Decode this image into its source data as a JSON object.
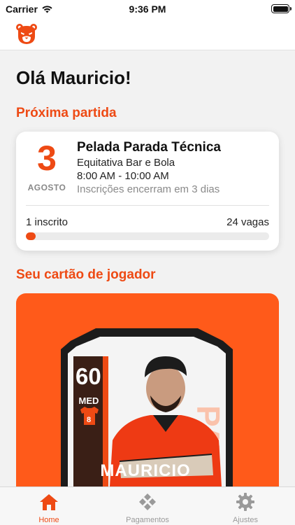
{
  "status": {
    "carrier": "Carrier",
    "time": "9:36 PM"
  },
  "header": {
    "logo_icon": "bear-logo-icon"
  },
  "greeting": "Olá Mauricio!",
  "next_match": {
    "section_title": "Próxima partida",
    "day": "3",
    "month": "AGOSTO",
    "title": "Pelada Parada Técnica",
    "venue": "Equitativa Bar e Bola",
    "time": "8:00 AM - 10:00 AM",
    "deadline": "Inscrições encerram em 3 dias",
    "registered": "1 inscrito",
    "slots": "24 vagas",
    "fill_fraction": 0.04
  },
  "player_card": {
    "section_title": "Seu cartão de jogador",
    "rating": "60",
    "position": "MED",
    "shirt_number": "8",
    "name": "MAURICIO",
    "team_watermark": "PATO FC"
  },
  "tabs": [
    {
      "label": "Home",
      "icon": "house-icon",
      "active": true
    },
    {
      "label": "Pagamentos",
      "icon": "payments-icon",
      "active": false
    },
    {
      "label": "Ajustes",
      "icon": "gear-icon",
      "active": false
    }
  ],
  "colors": {
    "accent": "#ee4a14",
    "card_bg": "#ff5a1a",
    "inactive": "#9a9a9a"
  }
}
